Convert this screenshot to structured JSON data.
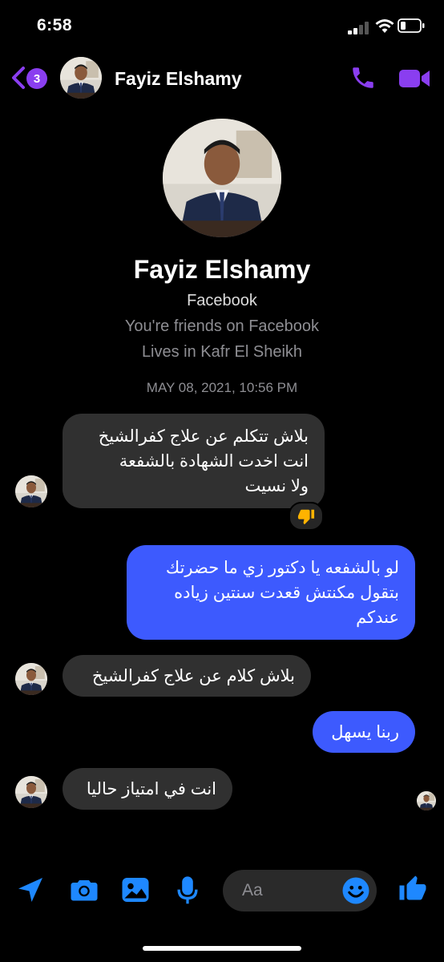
{
  "status_bar": {
    "time": "6:58"
  },
  "header": {
    "unread_count": "3",
    "contact_name": "Fayiz Elshamy"
  },
  "profile": {
    "name": "Fayiz Elshamy",
    "platform": "Facebook",
    "friends_text": "You're friends on Facebook",
    "lives_text": "Lives in Kafr El Sheikh"
  },
  "conversation": {
    "timestamp": "MAY 08, 2021, 10:56 PM",
    "messages": [
      {
        "from": "contact",
        "lines": [
          "بلاش تتكلم عن علاج كفرالشيخ",
          "انت اخدت الشهادة بالشفعة",
          "ولا نسيت"
        ],
        "reaction": "👎"
      },
      {
        "from": "me",
        "lines": [
          "لو بالشفعه يا دكتور زي ما حضرتك",
          "بتقول مكنتش قعدت سنتين زياده",
          "عندكم"
        ]
      },
      {
        "from": "contact",
        "lines": [
          "بلاش كلام عن علاج كفرالشيخ"
        ]
      },
      {
        "from": "me",
        "lines": [
          "ربنا يسهل"
        ]
      },
      {
        "from": "contact",
        "lines": [
          "انت في امتياز حاليا"
        ]
      }
    ]
  },
  "composer": {
    "placeholder": "Aa"
  },
  "colors": {
    "accent": "#8a3ef0",
    "outgoing_bubble": "#3d5afe",
    "incoming_bubble": "#303030",
    "toolbar_icon": "#1e88ff"
  },
  "icons": [
    "back-chevron-icon",
    "phone-icon",
    "video-camera-icon",
    "location-arrow-icon",
    "camera-icon",
    "image-icon",
    "microphone-icon",
    "emoji-icon",
    "thumbs-up-icon",
    "thumbs-down-icon"
  ]
}
